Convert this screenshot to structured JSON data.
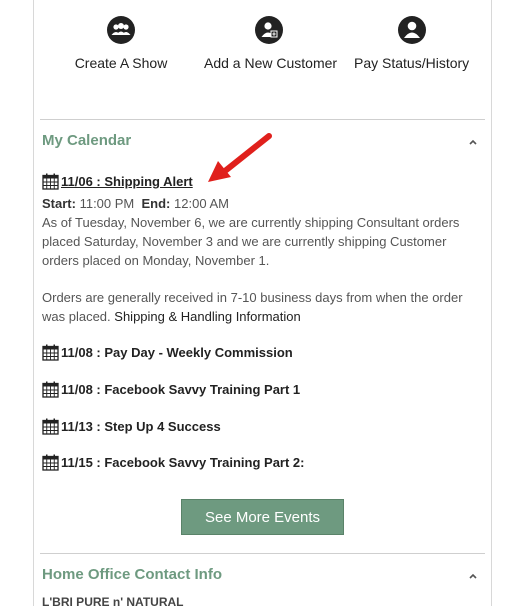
{
  "quick_links": [
    {
      "label": "Create A Show",
      "icon": "group-icon"
    },
    {
      "label": "Add a New Customer",
      "icon": "add-customer-icon"
    },
    {
      "label": "Pay Status/History",
      "icon": "user-icon"
    }
  ],
  "calendar": {
    "title": "My Calendar",
    "events": [
      {
        "title": "11/06 : Shipping Alert",
        "start_label": "Start:",
        "start_value": "11:00 PM",
        "end_label": "End:",
        "end_value": "12:00 AM",
        "paragraph1": "As of Tuesday, November 6, we are currently shipping Consultant orders placed Saturday, November 3 and we are currently shipping Customer orders placed on Monday, November 1.",
        "paragraph2": "Orders are generally received in 7-10 business days from when the order was placed.",
        "link": "Shipping & Handling Information"
      },
      {
        "title": "11/08 : Pay Day - Weekly Commission"
      },
      {
        "title": "11/08 : Facebook Savvy Training Part 1"
      },
      {
        "title": "11/13 : Step Up 4 Success"
      },
      {
        "title": "11/15 : Facebook Savvy Training Part 2:"
      }
    ],
    "see_more_label": "See More Events"
  },
  "home_office": {
    "title": "Home Office Contact Info",
    "company": "L'BRI PURE n' NATURAL"
  },
  "colors": {
    "accent": "#6e9a80",
    "annotation_arrow": "#e0201c"
  }
}
